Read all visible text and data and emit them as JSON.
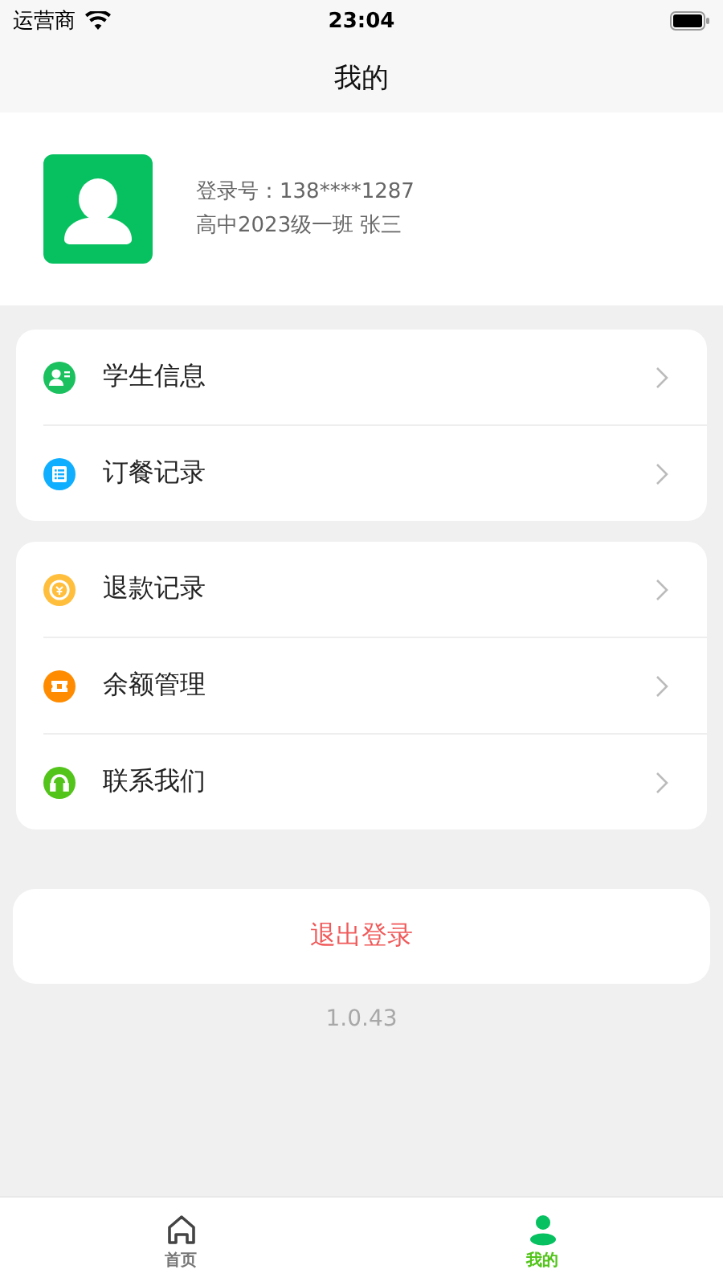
{
  "status_bar": {
    "carrier": "运营商",
    "time": "23:04"
  },
  "nav": {
    "title": "我的"
  },
  "profile": {
    "login": "登录号：138****1287",
    "class_name": "高中2023级一班 张三"
  },
  "menu_groups": [
    [
      {
        "label": "学生信息",
        "kind": "student",
        "color": "#1ac15e"
      },
      {
        "label": "订餐记录",
        "kind": "list",
        "color": "#10aeff"
      }
    ],
    [
      {
        "label": "退款记录",
        "kind": "refund",
        "color": "#ffbe3c"
      },
      {
        "label": "余额管理",
        "kind": "ticket",
        "color": "#ff8c00"
      },
      {
        "label": "联系我们",
        "kind": "headset",
        "color": "#52c41a"
      }
    ]
  ],
  "logout": "退出登录",
  "version": "1.0.43",
  "tabs": [
    {
      "label": "首页",
      "kind": "home",
      "selected": false
    },
    {
      "label": "我的",
      "kind": "profile",
      "selected": true
    }
  ]
}
